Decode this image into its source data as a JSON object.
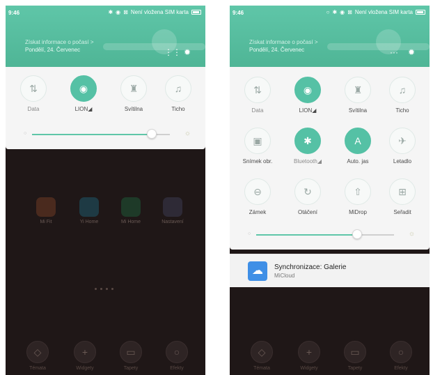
{
  "status": {
    "time": "9:46",
    "carrier": "Není vložena SIM karta"
  },
  "header": {
    "line1": "Získat informace o počasí >",
    "line2": "Pondělí, 24. Červenec"
  },
  "left_panel": {
    "tiles": [
      {
        "label": "Data",
        "icon": "data-icon",
        "glyph": "⇅",
        "on": false
      },
      {
        "label": "LION◢",
        "icon": "wifi-icon",
        "glyph": "◉",
        "on": true
      },
      {
        "label": "Svítilna",
        "icon": "flashlight-icon",
        "glyph": "♜",
        "on": false
      },
      {
        "label": "Ticho",
        "icon": "silent-icon",
        "glyph": "♫",
        "on": false
      }
    ],
    "brightness": 0.87
  },
  "right_panel": {
    "rows": [
      [
        {
          "label": "Data",
          "icon": "data-icon",
          "glyph": "⇅",
          "on": false
        },
        {
          "label": "LION◢",
          "icon": "wifi-icon",
          "glyph": "◉",
          "on": true
        },
        {
          "label": "Svítilna",
          "icon": "flashlight-icon",
          "glyph": "♜",
          "on": false
        },
        {
          "label": "Ticho",
          "icon": "silent-icon",
          "glyph": "♫",
          "on": false
        }
      ],
      [
        {
          "label": "Snímek obr.",
          "icon": "screenshot-icon",
          "glyph": "▣",
          "on": false
        },
        {
          "label": "Bluetooth◢",
          "icon": "bluetooth-icon",
          "glyph": "✱",
          "on": true
        },
        {
          "label": "Auto. jas",
          "icon": "auto-brightness-icon",
          "glyph": "A",
          "on": true
        },
        {
          "label": "Letadlo",
          "icon": "airplane-icon",
          "glyph": "✈",
          "on": false
        }
      ],
      [
        {
          "label": "Zámek",
          "icon": "lock-icon",
          "glyph": "⊖",
          "on": false
        },
        {
          "label": "Otáčení",
          "icon": "rotation-icon",
          "glyph": "↻",
          "on": false
        },
        {
          "label": "MiDrop",
          "icon": "midrop-icon",
          "glyph": "⇧",
          "on": false
        },
        {
          "label": "Seřadit",
          "icon": "sort-icon",
          "glyph": "⊞",
          "on": false
        }
      ]
    ],
    "brightness": 0.73
  },
  "notification": {
    "title": "Synchronizace: Galerie",
    "subtitle": "MiCloud"
  },
  "home": {
    "apps": [
      "Mi Fit",
      "Yi Home",
      "Mi Home",
      "Nastavení"
    ],
    "bottom": [
      "Témata",
      "Widgety",
      "Tapety",
      "Efekty"
    ]
  },
  "colors": {
    "accent": "#55c1a5",
    "header": "#5fc6a8",
    "notif_icon": "#3f8fe6"
  }
}
